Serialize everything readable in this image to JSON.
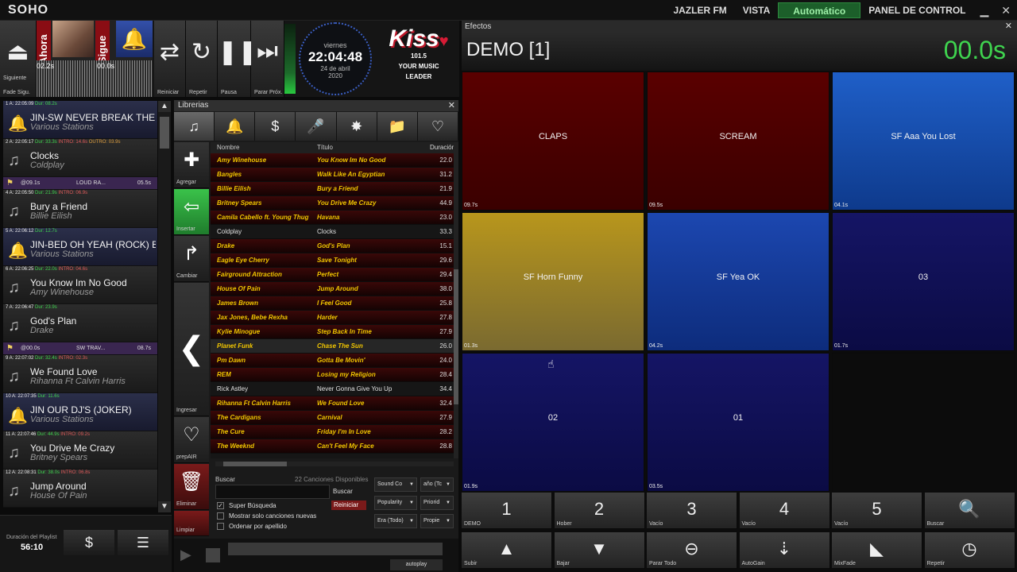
{
  "topbar": {
    "brand": "SOHO",
    "station": "JAZLER FM",
    "view": "VISTA",
    "mode": "Automático",
    "panel": "PANEL DE CONTROL",
    "minimize": "▁",
    "close": "✕"
  },
  "transport": {
    "eject_label": "Siguiente",
    "fade_label": "Fade Sigu.",
    "now_label": "Ahora",
    "next_label": "Sigue",
    "elapsed": "02.2s",
    "remaining": "00.0s",
    "reiniciar": "Reiniciar",
    "repetir": "Repetir",
    "pausa": "Pausa",
    "parar": "Parar Próx."
  },
  "clock": {
    "day": "viernes",
    "time": "22:04:48",
    "date": "24 de abril",
    "year": "2020"
  },
  "logo": {
    "name": "Kiss",
    "freq": "101.5",
    "slogan1": "YOUR MUSIC",
    "slogan2": "LEADER"
  },
  "playlist": {
    "items": [
      {
        "meta": "1  A: 22:05:09",
        "dur": "Dur: 08.2s",
        "intro": "",
        "outro": "",
        "title": "JIN-SW NEVER BREAK THE...",
        "artist": "Various Stations",
        "jingle": true
      },
      {
        "meta": "2  A: 22:05:17",
        "dur": "Dur: 33.3s",
        "intro": "INTRO: 14.6s",
        "outro": "OUTRO: 03.9s",
        "title": "Clocks",
        "artist": "Coldplay",
        "jingle": false
      },
      {
        "meta": "4  A: 22:05:50",
        "dur": "Dur: 21.9s",
        "intro": "INTRO: 06.9s",
        "outro": "",
        "title": "Bury a Friend",
        "artist": "Billie Eilish",
        "jingle": false
      },
      {
        "meta": "5  A: 22:06:12",
        "dur": "Dur: 12.7s",
        "intro": "",
        "outro": "",
        "title": "JIN-BED OH YEAH (ROCK) B...",
        "artist": "Various Stations",
        "jingle": true
      },
      {
        "meta": "6  A: 22:06:25",
        "dur": "Dur: 22.0s",
        "intro": "INTRO: 04.6s",
        "outro": "",
        "title": "You Know Im No Good",
        "artist": "Amy Winehouse",
        "jingle": false
      },
      {
        "meta": "7  A: 22:06:47",
        "dur": "Dur: 23.9s",
        "intro": "",
        "outro": "",
        "title": "God's Plan",
        "artist": "Drake",
        "jingle": false
      },
      {
        "meta": "9  A: 22:07:02",
        "dur": "Dur: 32.4s",
        "intro": "INTRO: 02.3s",
        "outro": "",
        "title": "We Found Love",
        "artist": "Rihanna Ft Calvin Harris",
        "jingle": false
      },
      {
        "meta": "10  A: 22:07:35",
        "dur": "Dur: 11.6s",
        "intro": "",
        "outro": "",
        "title": "JIN OUR DJ'S (JOKER)",
        "artist": "Various Stations",
        "jingle": true
      },
      {
        "meta": "11  A: 22:07:46",
        "dur": "Dur: 44.9s",
        "intro": "INTRO: 09.2s",
        "outro": "",
        "title": "You Drive Me Crazy",
        "artist": "Britney Spears",
        "jingle": false
      },
      {
        "meta": "12  A: 22:08:31",
        "dur": "Dur: 38.0s",
        "intro": "INTRO: 06.8s",
        "outro": "",
        "title": "Jump Around",
        "artist": "House Of Pain",
        "jingle": false
      }
    ],
    "fx1": {
      "a": "@09.1s",
      "b": "LOUD RA...",
      "c": "05.5s"
    },
    "fx2": {
      "a": "@00.0s",
      "b": "SW TRAV...",
      "c": "08.7s"
    },
    "duration_label": "Duración del Playlist",
    "duration": "56:10"
  },
  "library": {
    "title": "Librerias",
    "close": "✕",
    "side": {
      "agregar": "Agregar",
      "insertar": "Insertar",
      "cambiar": "Cambiar",
      "ingresar": "Ingresar",
      "prepair": "prepAIR",
      "eliminar": "Eliminar",
      "limpiar": "Limpiar"
    },
    "cols": {
      "name": "Nombre",
      "title": "Título",
      "dur": "Duración"
    },
    "rows": [
      {
        "n": "Amy Winehouse",
        "t": "You Know Im No Good",
        "d": "22.0",
        "s": "red"
      },
      {
        "n": "Bangles",
        "t": "Walk Like An Egyptian",
        "d": "31.2",
        "s": "red"
      },
      {
        "n": "Billie Eilish",
        "t": "Bury a Friend",
        "d": "21.9",
        "s": "red"
      },
      {
        "n": "Britney Spears",
        "t": "You Drive Me Crazy",
        "d": "44.9",
        "s": "red"
      },
      {
        "n": "Camila Cabello ft. Young Thug",
        "t": "Havana",
        "d": "23.0",
        "s": "red"
      },
      {
        "n": "Coldplay",
        "t": "Clocks",
        "d": "33.3",
        "s": "plain"
      },
      {
        "n": "Drake",
        "t": "God's Plan",
        "d": "15.1",
        "s": "red"
      },
      {
        "n": "Eagle Eye Cherry",
        "t": "Save Tonight",
        "d": "29.6",
        "s": "red"
      },
      {
        "n": "Fairground Attraction",
        "t": "Perfect",
        "d": "29.4",
        "s": "red"
      },
      {
        "n": "House Of Pain",
        "t": "Jump Around",
        "d": "38.0",
        "s": "red"
      },
      {
        "n": "James Brown",
        "t": "I Feel Good",
        "d": "25.8",
        "s": "red"
      },
      {
        "n": "Jax Jones, Bebe Rexha",
        "t": "Harder",
        "d": "27.8",
        "s": "red"
      },
      {
        "n": "Kylie Minogue",
        "t": "Step Back In Time",
        "d": "27.9",
        "s": "red"
      },
      {
        "n": "Planet Funk",
        "t": "Chase The Sun",
        "d": "26.0",
        "s": "sel"
      },
      {
        "n": "Pm Dawn",
        "t": "Gotta Be Movin'",
        "d": "24.0",
        "s": "red"
      },
      {
        "n": "REM",
        "t": "Losing my Religion",
        "d": "28.4",
        "s": "red"
      },
      {
        "n": "Rick Astley",
        "t": "Never Gonna Give You Up",
        "d": "34.4",
        "s": "plain"
      },
      {
        "n": "Rihanna Ft Calvin Harris",
        "t": "We Found Love",
        "d": "32.4",
        "s": "red"
      },
      {
        "n": "The Cardigans",
        "t": "Carnival",
        "d": "27.9",
        "s": "red"
      },
      {
        "n": "The Cure",
        "t": "Friday I'm In Love",
        "d": "28.2",
        "s": "red"
      },
      {
        "n": "The Weeknd",
        "t": "Can't Feel My Face",
        "d": "28.8",
        "s": "red"
      }
    ],
    "search": {
      "label": "Buscar",
      "count": "22 Canciones Disponibles",
      "buscar_btn": "Buscar",
      "reiniciar_btn": "Reiniciar",
      "super": "Super Búsqueda",
      "nuevas": "Mostrar solo canciones nuevas",
      "orden": "Ordenar por apellido"
    },
    "dropdowns": [
      "Sound Co",
      "año (Tc",
      "Popularity",
      "Priorid",
      "Era (Todo)",
      "Propie"
    ],
    "autoplay": "autoplay"
  },
  "effects": {
    "title": "Efectos",
    "close": "✕",
    "set": "DEMO [1]",
    "timer": "00.0s",
    "pads": [
      {
        "name": "CLAPS",
        "dur": "09.7s",
        "style": "red"
      },
      {
        "name": "SCREAM",
        "dur": "09.5s",
        "style": "red"
      },
      {
        "name": "SF Aaa You Lost",
        "dur": "04.1s",
        "style": "blue"
      },
      {
        "name": "SF Horn Funny",
        "dur": "01.3s",
        "style": "gold"
      },
      {
        "name": "SF Yea OK",
        "dur": "04.2s",
        "style": "mid"
      },
      {
        "name": "03",
        "dur": "01.7s",
        "style": "dark"
      },
      {
        "name": "02",
        "dur": "01.9s",
        "style": "dark"
      },
      {
        "name": "01",
        "dur": "03.5s",
        "style": "dark"
      },
      {
        "name": "",
        "dur": "",
        "style": "empty"
      }
    ],
    "bank": [
      {
        "g": "1",
        "l": "DEMO"
      },
      {
        "g": "2",
        "l": "Hober"
      },
      {
        "g": "3",
        "l": "Vacío"
      },
      {
        "g": "4",
        "l": "Vacío"
      },
      {
        "g": "5",
        "l": "Vacío"
      },
      {
        "g": "🔍",
        "l": "Buscar"
      }
    ],
    "ctrl": [
      {
        "g": "▲",
        "l": "Subir"
      },
      {
        "g": "▼",
        "l": "Bajar"
      },
      {
        "g": "⊖",
        "l": "Parar Todo"
      },
      {
        "g": "⇣",
        "l": "AutoGain"
      },
      {
        "g": "◣",
        "l": "MixFade"
      },
      {
        "g": "◷",
        "l": "Repetir"
      }
    ]
  }
}
